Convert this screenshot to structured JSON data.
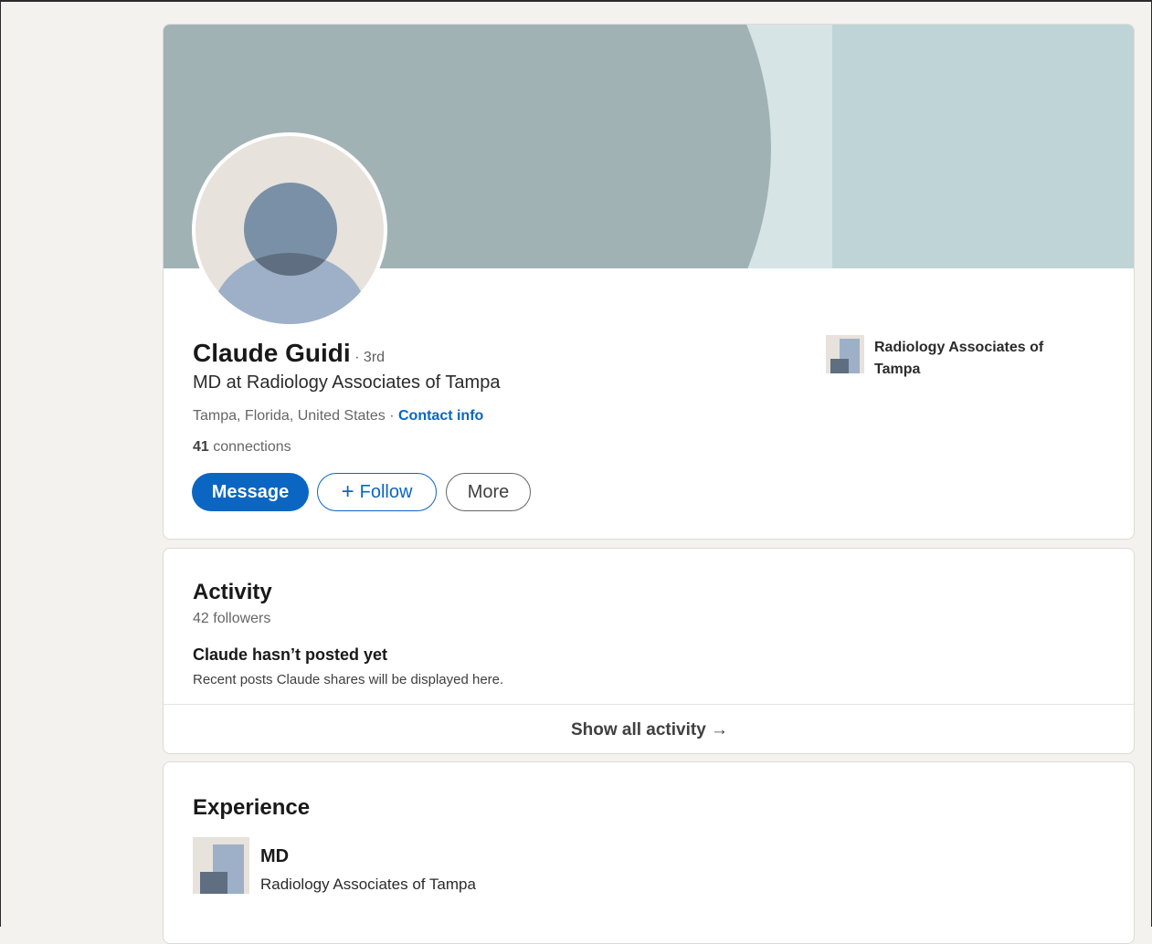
{
  "profile": {
    "name": "Claude Guidi",
    "degree": "· 3rd",
    "headline": "MD at Radiology Associates of Tampa",
    "location": "Tampa, Florida, United States",
    "location_separator": " · ",
    "contact_label": "Contact info",
    "connections_count": "41",
    "connections_label": "connections",
    "current_company": "Radiology Associates of Tampa"
  },
  "actions": {
    "message": "Message",
    "follow_icon": "+",
    "follow": "Follow",
    "more": "More"
  },
  "activity": {
    "title": "Activity",
    "followers": "42 followers",
    "empty_title": "Claude hasn’t posted yet",
    "empty_sub": "Recent posts Claude shares will be displayed here.",
    "show_all": "Show all activity →"
  },
  "experience": {
    "title": "Experience",
    "items": [
      {
        "role": "MD",
        "company": "Radiology Associates of Tampa"
      }
    ]
  },
  "colors": {
    "accent": "#0a66c2",
    "page_bg": "#f4f2ee",
    "banner_dark": "#a1b2b5",
    "banner_light": "#bfd4d7"
  },
  "icons": {
    "avatar": "default-person-icon",
    "company_logo": "company-placeholder-icon",
    "arrow": "arrow-right-icon"
  }
}
